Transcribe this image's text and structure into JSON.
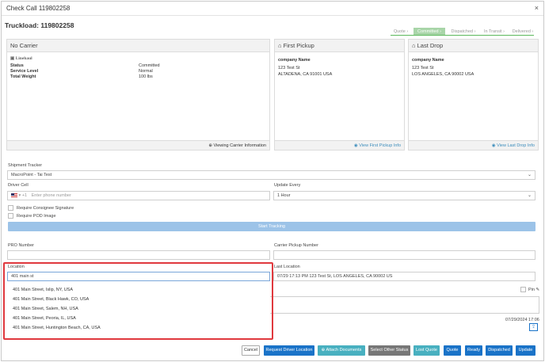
{
  "header": {
    "title": "Check Call 119802258",
    "close": "×"
  },
  "truckload_title": "Truckload: 119802258",
  "status_steps": [
    {
      "label": "Quote",
      "active": false
    },
    {
      "label": "Committed",
      "active": true
    },
    {
      "label": "Dispatched",
      "active": false
    },
    {
      "label": "In Transit",
      "active": false
    },
    {
      "label": "Delivered",
      "active": false
    }
  ],
  "carrier_panel": {
    "title": "No Carrier",
    "logo_text": "Linehaul",
    "rows": [
      {
        "label": "Status",
        "value": "Committed"
      },
      {
        "label": "Service Level",
        "value": "Normal"
      },
      {
        "label": "Total Weight",
        "value": "100 lbs"
      }
    ],
    "footer_link": "Viewing Carrier Information"
  },
  "first_pickup": {
    "title": "First Pickup",
    "company": "company Name",
    "line1": "123 Test St",
    "line2": "ALTADENA, CA 91001 USA",
    "footer_link": "View First Pickup Info"
  },
  "last_drop": {
    "title": "Last Drop",
    "company": "company Name",
    "line1": "123 Test St",
    "line2": "LOS ANGELES, CA 90002 USA",
    "footer_link": "View Last Drop Info"
  },
  "form": {
    "shipment_tracker_label": "Shipment Tracker",
    "shipment_tracker_value": "MacroPoint - Tai Test",
    "driver_cell_label": "Driver Cell",
    "driver_cell_code": "+1",
    "driver_cell_placeholder": "Enter phone number",
    "update_every_label": "Update Every",
    "update_every_value": "1 Hour",
    "require_consignee": "Require Consignee Signature",
    "require_pod": "Require POD Image",
    "start_tracking": "Start Tracking",
    "pro_number_label": "PRO Number",
    "carrier_pickup_label": "Carrier Pickup Number",
    "location_label": "Location",
    "location_value": "401 main st",
    "last_location_label": "Last Location",
    "last_location_value": "07/29 17:13 PM 123 Test St, LOS ANGELES, CA 90002 US",
    "pin_label": "Pin",
    "date_value": "07/29/2024 17:06"
  },
  "suggestions": [
    "401 Main Street, Islip, NY, USA",
    "401 Main Street, Black Hawk, CO, USA",
    "401 Main Street, Salem, NH, USA",
    "401 Main Street, Peoria, IL, USA",
    "401 Main Street, Huntington Beach, CA, USA"
  ],
  "buttons": {
    "cancel": "Cancel",
    "request_driver_location": "Request Driver Location",
    "attach_documents": "Attach Documents",
    "select_other_status": "Select Other Status",
    "lost_quote": "Lost Quote",
    "quote": "Quote",
    "ready": "Ready",
    "dispatched": "Dispatched",
    "update": "Update"
  },
  "colors": {
    "primary": "#1a73c8",
    "committed_step": "#a8d5a8",
    "start_tracking": "#9cc3e8",
    "highlight": "#e0393e"
  }
}
